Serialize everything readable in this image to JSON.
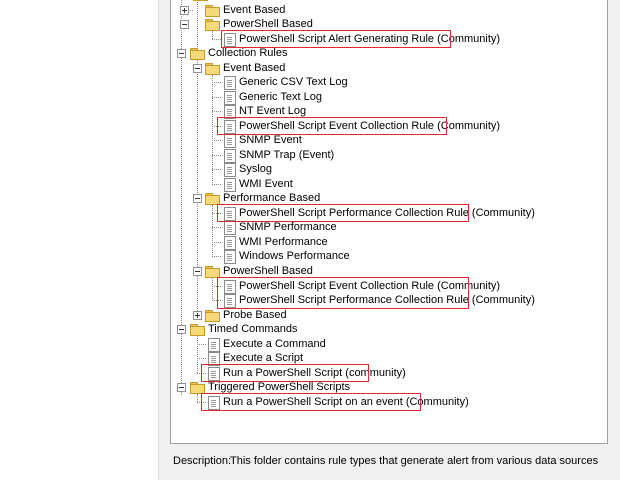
{
  "tree": {
    "nodes": [
      {
        "id": "alert-event",
        "label": "",
        "type": "folder",
        "level": 1,
        "expander": "none",
        "selected": true
      },
      {
        "id": "alert-event2",
        "label": "Event Based",
        "type": "folder",
        "level": 1,
        "expander": "collapsed"
      },
      {
        "id": "alert-ps",
        "label": "PowerShell Based",
        "type": "folder",
        "level": 1,
        "expander": "expanded"
      },
      {
        "id": "alert-ps-rule",
        "label": "PowerShell Script Alert Generating Rule (Community)",
        "type": "doc",
        "level": 2,
        "expander": "none"
      },
      {
        "id": "collection-rules",
        "label": "Collection Rules",
        "type": "folder",
        "level": 0,
        "expander": "expanded"
      },
      {
        "id": "coll-event",
        "label": "Event Based",
        "type": "folder",
        "level": 1,
        "expander": "expanded"
      },
      {
        "id": "csv-log",
        "label": "Generic CSV Text Log",
        "type": "doc",
        "level": 2,
        "expander": "none"
      },
      {
        "id": "text-log",
        "label": "Generic Text Log",
        "type": "doc",
        "level": 2,
        "expander": "none"
      },
      {
        "id": "nt-log",
        "label": "NT Event Log",
        "type": "doc",
        "level": 2,
        "expander": "none"
      },
      {
        "id": "ps-event-coll",
        "label": "PowerShell Script Event Collection Rule (Community)",
        "type": "doc",
        "level": 2,
        "expander": "none"
      },
      {
        "id": "snmp-event",
        "label": "SNMP Event",
        "type": "doc",
        "level": 2,
        "expander": "none"
      },
      {
        "id": "snmp-trap",
        "label": "SNMP Trap (Event)",
        "type": "doc",
        "level": 2,
        "expander": "none"
      },
      {
        "id": "syslog",
        "label": "Syslog",
        "type": "doc",
        "level": 2,
        "expander": "none"
      },
      {
        "id": "wmi-event",
        "label": "WMI Event",
        "type": "doc",
        "level": 2,
        "expander": "none"
      },
      {
        "id": "perf-based",
        "label": "Performance Based",
        "type": "folder",
        "level": 1,
        "expander": "expanded"
      },
      {
        "id": "ps-perf-coll",
        "label": "PowerShell Script Performance Collection Rule (Community)",
        "type": "doc",
        "level": 2,
        "expander": "none"
      },
      {
        "id": "snmp-perf",
        "label": "SNMP Performance",
        "type": "doc",
        "level": 2,
        "expander": "none"
      },
      {
        "id": "wmi-perf",
        "label": "WMI Performance",
        "type": "doc",
        "level": 2,
        "expander": "none"
      },
      {
        "id": "win-perf",
        "label": "Windows Performance",
        "type": "doc",
        "level": 2,
        "expander": "none"
      },
      {
        "id": "coll-ps",
        "label": "PowerShell Based",
        "type": "folder",
        "level": 1,
        "expander": "expanded"
      },
      {
        "id": "ps-event-coll2",
        "label": "PowerShell Script Event Collection Rule (Community)",
        "type": "doc",
        "level": 2,
        "expander": "none"
      },
      {
        "id": "ps-perf-coll2",
        "label": "PowerShell Script Performance Collection Rule (Community)",
        "type": "doc",
        "level": 2,
        "expander": "none"
      },
      {
        "id": "probe-based",
        "label": "Probe Based",
        "type": "folder",
        "level": 1,
        "expander": "collapsed"
      },
      {
        "id": "timed-commands",
        "label": "Timed Commands",
        "type": "folder",
        "level": 0,
        "expander": "expanded"
      },
      {
        "id": "exec-command",
        "label": "Execute a Command",
        "type": "doc",
        "level": 1,
        "expander": "none"
      },
      {
        "id": "exec-script",
        "label": "Execute a Script",
        "type": "doc",
        "level": 1,
        "expander": "none"
      },
      {
        "id": "run-ps",
        "label": "Run a PowerShell Script (community)",
        "type": "doc",
        "level": 1,
        "expander": "none"
      },
      {
        "id": "triggered-ps",
        "label": "Triggered PowerShell Scripts",
        "type": "folder",
        "level": 0,
        "expander": "expanded"
      },
      {
        "id": "run-ps-event",
        "label": "Run a PowerShell Script on an event (Community)",
        "type": "doc",
        "level": 1,
        "expander": "none"
      }
    ]
  },
  "description": {
    "label": "Description:",
    "text": "This folder contains rule types that generate alert from various data sources"
  },
  "colors": {
    "highlight_border": "#e0282e",
    "selection": "#0a64d2"
  }
}
